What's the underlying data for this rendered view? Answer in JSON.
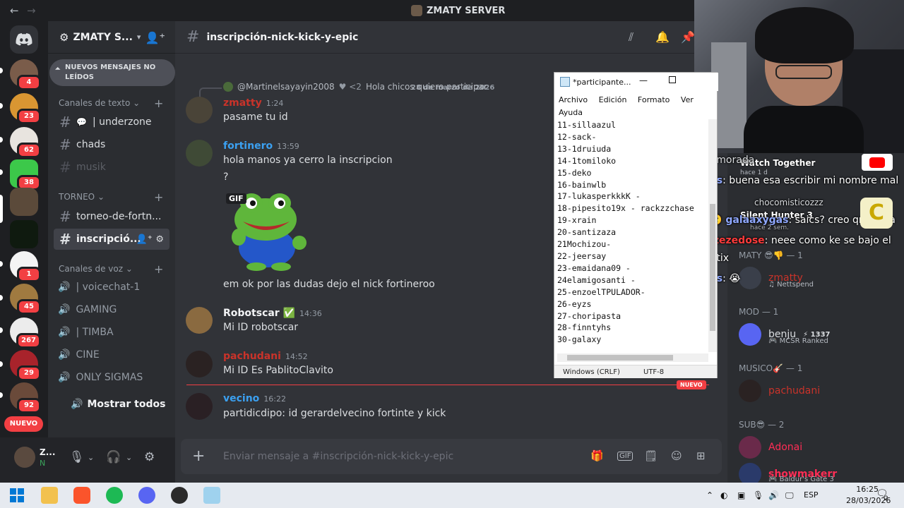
{
  "window": {
    "server_title": "ZMATY SERVER"
  },
  "server_rail": {
    "badges": [
      "4",
      "23",
      "62",
      "38",
      "1",
      "45",
      "267",
      "29",
      "92"
    ],
    "new_pill": "NUEVO"
  },
  "sidebar": {
    "server_name": "ZMATY S...",
    "new_messages_banner": "NUEVOS MENSAJES NO LEÍDOS",
    "text_category": "Canales de texto",
    "channels": [
      "| underzone",
      "chads",
      "musik"
    ],
    "torneo_category": "TORNEO",
    "torneo_channels": [
      "torneo-de-fortn...",
      "inscripció..."
    ],
    "voice_category": "Canales de voz",
    "voice_channels": [
      "| voicechat-1",
      "GAMING",
      "| TIMBA",
      "CINE",
      "ONLY SIGMAS"
    ],
    "show_all": "Mostrar todos"
  },
  "user_panel": {
    "name": "Z...",
    "status": "N"
  },
  "chat": {
    "channel_name": "inscripción-nick-kick-y-epic",
    "date_divider": "28 de marzo de 2026",
    "reply": {
      "author": "@Martinelsayayin2008",
      "badge": "<2",
      "text": "Hola chicos quiero participar"
    },
    "messages": [
      {
        "author": "zmatty",
        "time": "1:24",
        "color": "#c9332a",
        "text": "pasame tu id"
      },
      {
        "author": "fortinero",
        "time": "13:59",
        "color": "#3ba0f0",
        "text": "hola manos ya cerro la inscripcion",
        "text2": "?",
        "gif_label": "GIF",
        "text3": "em ok por las dudas dejo el nick fortineroo"
      },
      {
        "author": "Robotscar",
        "time": "14:36",
        "color": "#f2f3f5",
        "text": "Mi ID robotscar"
      },
      {
        "author": "pachudani",
        "time": "14:52",
        "color": "#c9332a",
        "text": "Mi ID Es PablitoClavito"
      },
      {
        "author": "vecino",
        "time": "16:22",
        "color": "#3ba0f0",
        "text": "partidicdipo: id gerardelvecino fortinte y kick"
      }
    ],
    "new_tag": "NUEVO",
    "composer_placeholder": "Enviar mensaje a #inscripción-nick-kick-y-epic"
  },
  "notepad": {
    "title": "*participante...",
    "menu": [
      "Archivo",
      "Edición",
      "Formato",
      "Ver",
      "Ayuda"
    ],
    "lines": [
      "11-sillaazul",
      "12-sack-",
      "13-1druiuda",
      "14-1tomiloko",
      "15-deko",
      "16-bainwlb",
      "17-lukasperkkkK -",
      "18-pipesito19x - rackzzchase",
      "19-xrain",
      "20-santizaza",
      "21Mochizou-",
      "22-jeersay",
      "23-emaidana09 -",
      "24elamigosanti -",
      "25-enzoelTPULADOR-",
      "26-eyzs",
      "27-choripasta",
      "28-finntyhs",
      "30-galaxy"
    ],
    "encoding_eol": "Windows (CRLF)",
    "encoding": "UTF-8"
  },
  "overlay": {
    "watch_together": "Watch Together",
    "watch_together_time": "hace 1 d",
    "enamorada": "Enamorada",
    "chat": [
      {
        "user": "eyzs",
        "color": "#8fa8ff",
        "text": ": buena esa escribir mi nombre mal"
      },
      {
        "user": "chocomisticozzz",
        "color": "#b5bac1",
        "text": ""
      },
      {
        "user": "Silent Hunter 3",
        "color": "#ffffff",
        "text": ""
      },
      {
        "user": "galaaxygas",
        "color": "#8fa8ff",
        "text": ": saics? creo qno esta"
      },
      {
        "user": "zezedose",
        "color": "#ff3b3b",
        "text": ": neee como ke se bajo el"
      },
      {
        "user": "",
        "color": "#ffffff",
        "text": "bautix"
      },
      {
        "user": "eyzs",
        "color": "#8fa8ff",
        "text": ":"
      }
    ],
    "silent_hunter_time": "hace 2 sem."
  },
  "members": {
    "groups": [
      {
        "label": "MATY 😎👎 — 1",
        "members": [
          {
            "name": "zmatty",
            "sub": "Nettspend",
            "color": "#c9332a"
          }
        ]
      },
      {
        "label": "MOD — 1",
        "members": [
          {
            "name": "benju",
            "sub": "MCSR Ranked",
            "badge": "1337",
            "color": "#dbdee1"
          }
        ]
      },
      {
        "label": "MUSICO🎸 — 1",
        "members": [
          {
            "name": "pachudani",
            "sub": "",
            "color": "#c9332a"
          }
        ]
      },
      {
        "label": "SUB😎 — 2",
        "members": [
          {
            "name": "Adonai",
            "sub": "",
            "color": "#ff2d55"
          },
          {
            "name": "showmakerr",
            "sub": "Baldur's Gate 3",
            "color": "#ff2d55"
          }
        ]
      }
    ]
  },
  "taskbar": {
    "lang": "ESP",
    "time": "16:25",
    "date": "28/03/2026",
    "notif_count": "2"
  },
  "colors": {
    "accent_red": "#f23f43",
    "link_blue": "#3ba0f0",
    "bg_main": "#313338",
    "bg_sidebar": "#2b2d31"
  }
}
